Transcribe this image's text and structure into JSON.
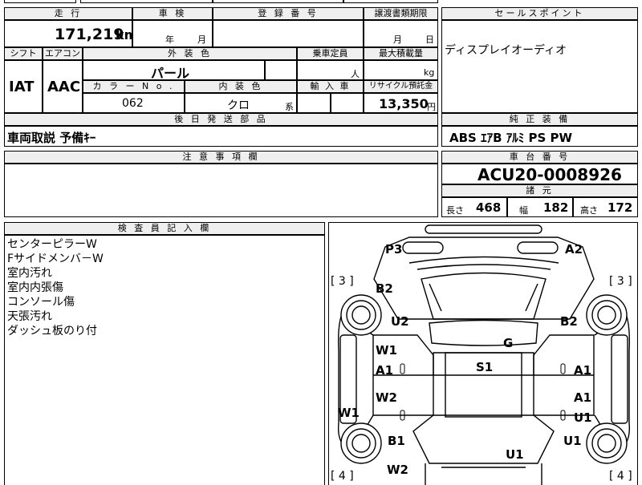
{
  "top": {
    "headers": {
      "mileage": "走 行",
      "inspection": "車 検",
      "registration": "登 録 番 号",
      "transfer_deadline": "譲渡書類期限",
      "sales_point": "セールスポイント"
    },
    "mileage_value": "171,219",
    "mileage_unit": "km",
    "inspection_year": "年",
    "inspection_month": "月",
    "transfer_month": "月",
    "transfer_day": "日",
    "sales_point_text": "ディスプレイオーディオ"
  },
  "spec": {
    "headers": {
      "shift": "シフト",
      "aircon": "エアコン",
      "exterior_color": "外 装 色",
      "capacity": "乗車定員",
      "max_load": "最大積載量",
      "color_no": "カ ラ ー N o .",
      "interior_color": "内 装 色",
      "import": "輸 入 車",
      "recycle": "リサイクル預託金"
    },
    "shift_value": "IAT",
    "aircon_value": "AAC",
    "exterior_color_value": "パール",
    "capacity_unit": "人",
    "max_load_unit": "kg",
    "color_no_value": "062",
    "interior_color_value": "クロ",
    "interior_suffix": "系",
    "recycle_value": "13,350",
    "recycle_unit": "円"
  },
  "later_parts": {
    "header": "後 日 発 送 部 品",
    "text": "車両取説 予備ｷｰ"
  },
  "equipment": {
    "header": "純 正 装 備",
    "text": "ABS ｴｱB ｱﾙﾐ PS PW"
  },
  "notes": {
    "header": "注 意 事 項 欄",
    "text": ""
  },
  "chassis": {
    "header": "車 台 番 号",
    "value": "ACU20-0008926"
  },
  "dimensions": {
    "header": "諸 元",
    "length_label": "長さ",
    "length_value": "468",
    "width_label": "幅",
    "width_value": "182",
    "height_label": "高さ",
    "height_value": "172"
  },
  "inspector": {
    "header": "検 査 員 記 入 欄",
    "lines": [
      "センターピラーW",
      "Fサイドメンバ－W",
      "室内汚れ",
      "室内内張傷",
      "コンソール傷",
      "天張汚れ",
      "ダッシュ板のり付"
    ]
  },
  "diagram": {
    "marks": [
      "P3",
      "A2",
      "B2",
      "U2",
      "B2",
      "W1",
      "A1",
      "G",
      "S1",
      "A1",
      "W2",
      "A1",
      "W1",
      "U1",
      "B1",
      "U1",
      "U1",
      "W2"
    ],
    "tire_labels": [
      "[ 3 ]",
      "[ 3 ]",
      "[ 4 ]",
      "[ 4 ]"
    ]
  }
}
